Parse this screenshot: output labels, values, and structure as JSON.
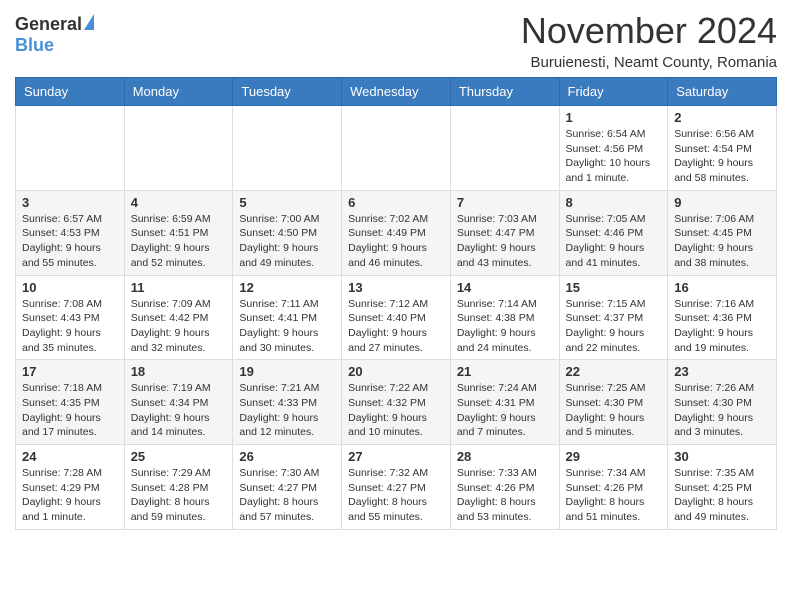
{
  "header": {
    "logo_general": "General",
    "logo_blue": "Blue",
    "month_title": "November 2024",
    "location": "Buruienesti, Neamt County, Romania"
  },
  "days_of_week": [
    "Sunday",
    "Monday",
    "Tuesday",
    "Wednesday",
    "Thursday",
    "Friday",
    "Saturday"
  ],
  "weeks": [
    [
      {
        "day": "",
        "info": ""
      },
      {
        "day": "",
        "info": ""
      },
      {
        "day": "",
        "info": ""
      },
      {
        "day": "",
        "info": ""
      },
      {
        "day": "",
        "info": ""
      },
      {
        "day": "1",
        "info": "Sunrise: 6:54 AM\nSunset: 4:56 PM\nDaylight: 10 hours and 1 minute."
      },
      {
        "day": "2",
        "info": "Sunrise: 6:56 AM\nSunset: 4:54 PM\nDaylight: 9 hours and 58 minutes."
      }
    ],
    [
      {
        "day": "3",
        "info": "Sunrise: 6:57 AM\nSunset: 4:53 PM\nDaylight: 9 hours and 55 minutes."
      },
      {
        "day": "4",
        "info": "Sunrise: 6:59 AM\nSunset: 4:51 PM\nDaylight: 9 hours and 52 minutes."
      },
      {
        "day": "5",
        "info": "Sunrise: 7:00 AM\nSunset: 4:50 PM\nDaylight: 9 hours and 49 minutes."
      },
      {
        "day": "6",
        "info": "Sunrise: 7:02 AM\nSunset: 4:49 PM\nDaylight: 9 hours and 46 minutes."
      },
      {
        "day": "7",
        "info": "Sunrise: 7:03 AM\nSunset: 4:47 PM\nDaylight: 9 hours and 43 minutes."
      },
      {
        "day": "8",
        "info": "Sunrise: 7:05 AM\nSunset: 4:46 PM\nDaylight: 9 hours and 41 minutes."
      },
      {
        "day": "9",
        "info": "Sunrise: 7:06 AM\nSunset: 4:45 PM\nDaylight: 9 hours and 38 minutes."
      }
    ],
    [
      {
        "day": "10",
        "info": "Sunrise: 7:08 AM\nSunset: 4:43 PM\nDaylight: 9 hours and 35 minutes."
      },
      {
        "day": "11",
        "info": "Sunrise: 7:09 AM\nSunset: 4:42 PM\nDaylight: 9 hours and 32 minutes."
      },
      {
        "day": "12",
        "info": "Sunrise: 7:11 AM\nSunset: 4:41 PM\nDaylight: 9 hours and 30 minutes."
      },
      {
        "day": "13",
        "info": "Sunrise: 7:12 AM\nSunset: 4:40 PM\nDaylight: 9 hours and 27 minutes."
      },
      {
        "day": "14",
        "info": "Sunrise: 7:14 AM\nSunset: 4:38 PM\nDaylight: 9 hours and 24 minutes."
      },
      {
        "day": "15",
        "info": "Sunrise: 7:15 AM\nSunset: 4:37 PM\nDaylight: 9 hours and 22 minutes."
      },
      {
        "day": "16",
        "info": "Sunrise: 7:16 AM\nSunset: 4:36 PM\nDaylight: 9 hours and 19 minutes."
      }
    ],
    [
      {
        "day": "17",
        "info": "Sunrise: 7:18 AM\nSunset: 4:35 PM\nDaylight: 9 hours and 17 minutes."
      },
      {
        "day": "18",
        "info": "Sunrise: 7:19 AM\nSunset: 4:34 PM\nDaylight: 9 hours and 14 minutes."
      },
      {
        "day": "19",
        "info": "Sunrise: 7:21 AM\nSunset: 4:33 PM\nDaylight: 9 hours and 12 minutes."
      },
      {
        "day": "20",
        "info": "Sunrise: 7:22 AM\nSunset: 4:32 PM\nDaylight: 9 hours and 10 minutes."
      },
      {
        "day": "21",
        "info": "Sunrise: 7:24 AM\nSunset: 4:31 PM\nDaylight: 9 hours and 7 minutes."
      },
      {
        "day": "22",
        "info": "Sunrise: 7:25 AM\nSunset: 4:30 PM\nDaylight: 9 hours and 5 minutes."
      },
      {
        "day": "23",
        "info": "Sunrise: 7:26 AM\nSunset: 4:30 PM\nDaylight: 9 hours and 3 minutes."
      }
    ],
    [
      {
        "day": "24",
        "info": "Sunrise: 7:28 AM\nSunset: 4:29 PM\nDaylight: 9 hours and 1 minute."
      },
      {
        "day": "25",
        "info": "Sunrise: 7:29 AM\nSunset: 4:28 PM\nDaylight: 8 hours and 59 minutes."
      },
      {
        "day": "26",
        "info": "Sunrise: 7:30 AM\nSunset: 4:27 PM\nDaylight: 8 hours and 57 minutes."
      },
      {
        "day": "27",
        "info": "Sunrise: 7:32 AM\nSunset: 4:27 PM\nDaylight: 8 hours and 55 minutes."
      },
      {
        "day": "28",
        "info": "Sunrise: 7:33 AM\nSunset: 4:26 PM\nDaylight: 8 hours and 53 minutes."
      },
      {
        "day": "29",
        "info": "Sunrise: 7:34 AM\nSunset: 4:26 PM\nDaylight: 8 hours and 51 minutes."
      },
      {
        "day": "30",
        "info": "Sunrise: 7:35 AM\nSunset: 4:25 PM\nDaylight: 8 hours and 49 minutes."
      }
    ]
  ]
}
